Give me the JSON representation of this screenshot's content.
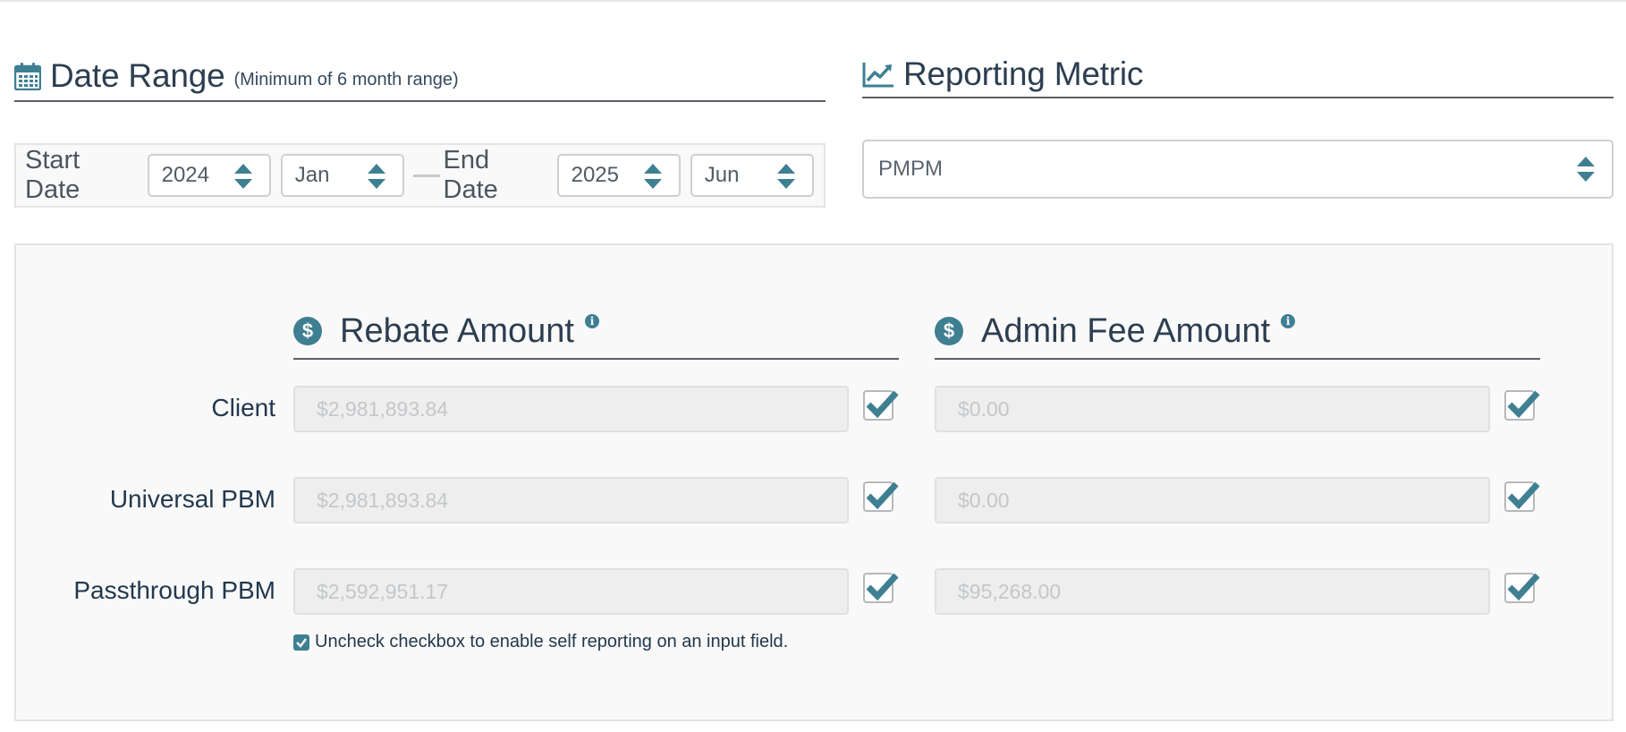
{
  "date_range": {
    "title": "Date Range",
    "subtitle": "(Minimum of 6 month range)",
    "start_label": "Start Date",
    "end_label": "End Date",
    "start_year": "2024",
    "start_month": "Jan",
    "end_year": "2025",
    "end_month": "Jun",
    "icon": "calendar-icon"
  },
  "reporting_metric": {
    "title": "Reporting Metric",
    "value": "PMPM",
    "icon": "line-chart-icon"
  },
  "amounts": {
    "rebate_title": "Rebate Amount",
    "admin_fee_title": "Admin Fee Amount",
    "rows": [
      {
        "label": "Client",
        "rebate": "$2,981,893.84",
        "admin_fee": "$0.00"
      },
      {
        "label": "Universal PBM",
        "rebate": "$2,981,893.84",
        "admin_fee": "$0.00"
      },
      {
        "label": "Passthrough PBM",
        "rebate": "$2,592,951.17",
        "admin_fee": "$95,268.00"
      }
    ],
    "note": "Uncheck checkbox to enable self reporting on an input field."
  },
  "colors": {
    "accent": "#3f7f92",
    "heading": "#2c3e50",
    "panel_bg": "#f9f9f9",
    "input_disabled_bg": "#eeeeee"
  }
}
